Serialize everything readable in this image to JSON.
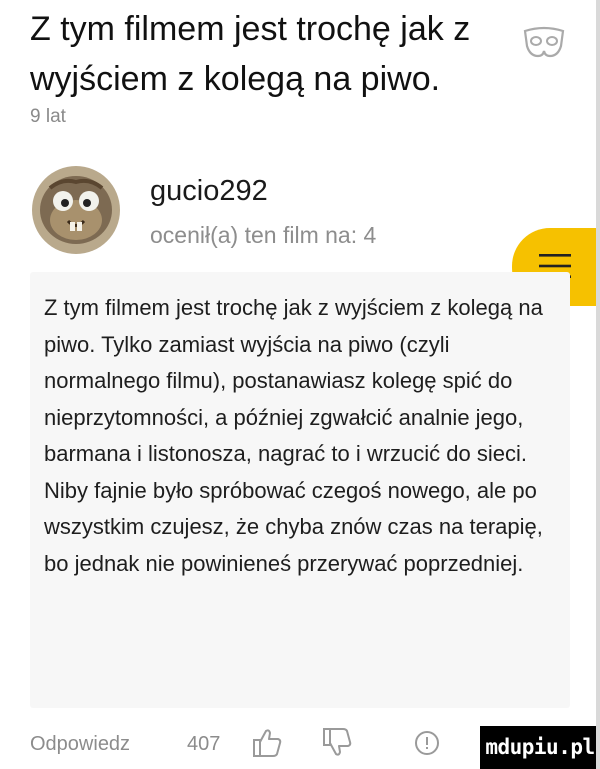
{
  "review": {
    "title": "Z tym filmem jest trochę jak z wyjściem z kolegą na piwo.",
    "age": "9 lat",
    "author": {
      "username": "gucio292",
      "rating_text": "ocenił(a) ten film na: 4"
    },
    "body": "Z tym filmem jest trochę jak z wyjściem z kolegą na piwo. Tylko zamiast wyjścia na piwo (czyli normalnego filmu), postanawiasz kolegę spić do nieprzytomności, a później zgwałcić analnie jego, barmana i listonosza, nagrać to i wrzucić do sieci. Niby fajnie było spróbować czegoś nowego, ale po wszystkim czujesz, że chyba znów czas na terapię, bo jednak nie powinieneś przerywać poprzedniej."
  },
  "footer": {
    "reply_label": "Odpowiedz",
    "votes": "407"
  },
  "icons": {
    "title": "spoiler-mask-icon",
    "menu": "hamburger-menu-icon",
    "like": "thumbs-up-icon",
    "dislike": "thumbs-down-icon",
    "info": "info-circle-icon"
  },
  "watermark": "mdupiu.pl",
  "colors": {
    "accent": "#f6c100",
    "card_background": "#f7f7f7",
    "muted_text": "#8c8c8c"
  }
}
